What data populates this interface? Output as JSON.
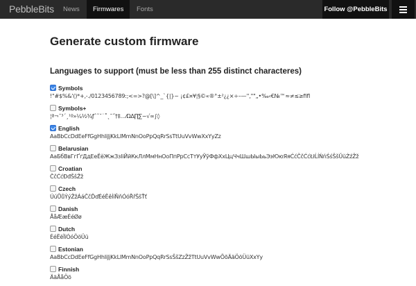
{
  "nav": {
    "brand": "PebbleBits",
    "items": [
      "News",
      "Firmwares",
      "Fonts"
    ],
    "follow": "Follow @PebbleBits"
  },
  "page": {
    "title": "Generate custom firmware",
    "section": "Languages to support (must be less than 255 distinct characteres)"
  },
  "languages": [
    {
      "name": "Symbols",
      "checked": true,
      "chars": "!\"#$%&'()*+,-./0123456789:;<=>?@[\\]^_`{|}~ ¡¢£¤¥¦§©«®°±²¿¿×÷–—''‚\"\"„•‰‹€№™≈≠≤≥ﬁﬂ"
    },
    {
      "name": "Symbols+",
      "checked": false,
      "chars": "¦ª¬¯³´¸¹º»¼½¾ƒˆˇ˘˙˚˛˜˝†‡…⁄ΩΔ∏∑−√∞∫◊"
    },
    {
      "name": "English",
      "checked": true,
      "chars": "AaBbCcDdEeFfGgHhIiJjKkLlMmNnOoPpQqRrSsTtUuVvWwXxYyZz"
    },
    {
      "name": "Belarusian",
      "checked": false,
      "chars": "АаБбВвГгҐґДдЕеЁёЖжЗзІіЙйКкЛлМмНнОоПпРрСсТтУуЎўФфХхЦцЧчШшЫыЬьЭэЮюЯяĆćČčĆćŁłĹĺŃńŚśŠšŬŭŹźŽž"
    },
    {
      "name": "Croatian",
      "checked": false,
      "chars": "ČčĆćĐđŠšŽž"
    },
    {
      "name": "Czech",
      "checked": false,
      "chars": "ÚúŮůÝýŽžÁáČčĎďÉéĚěÍíŇňÓóŘřŠšŤť"
    },
    {
      "name": "Danish",
      "checked": false,
      "chars": "ÅåÆæÉéØø"
    },
    {
      "name": "Dutch",
      "checked": false,
      "chars": "ÉéËëÏïÓóÖöÜü"
    },
    {
      "name": "Estonian",
      "checked": false,
      "chars": "AaBbCcDdEeFfGgHhIiJjKkLlMmNnOoPpQqRrSsŠšZzŽžTtUuVvWwÕõÄäÖöÜüXxYy"
    },
    {
      "name": "Finnish",
      "checked": false,
      "chars": "ÄäÅåÖö"
    }
  ]
}
